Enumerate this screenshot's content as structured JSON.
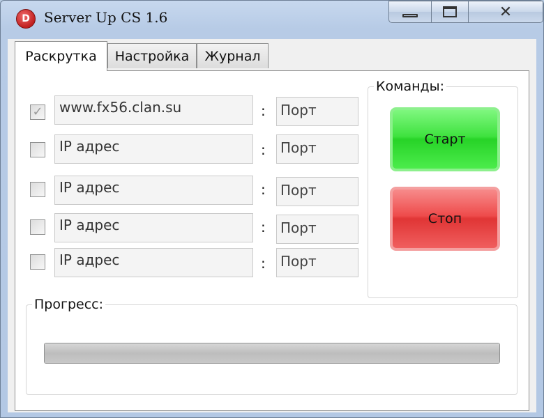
{
  "window": {
    "title": "Server Up CS 1.6",
    "icon_letter": "D",
    "close_glyph": "✕"
  },
  "tabs": [
    {
      "label": "Раскрутка",
      "active": true
    },
    {
      "label": "Настройка",
      "active": false
    },
    {
      "label": "Журнал",
      "active": false
    }
  ],
  "servers": [
    {
      "checked": true,
      "address": "www.fx56.clan.su",
      "port": "Порт"
    },
    {
      "checked": false,
      "address": "IP адрес",
      "port": "Порт"
    },
    {
      "checked": false,
      "address": "IP адрес",
      "port": "Порт"
    },
    {
      "checked": false,
      "address": "IP адрес",
      "port": "Порт"
    },
    {
      "checked": false,
      "address": "IP адрес",
      "port": "Порт"
    }
  ],
  "separator": ":",
  "check_glyph": "✓",
  "commands": {
    "label": "Команды:",
    "start_label": "Старт",
    "stop_label": "Стоп",
    "start_color": "#3fe23f",
    "stop_color": "#ee4b4b"
  },
  "progress": {
    "label": "Прогресс:",
    "value_percent": 100
  }
}
